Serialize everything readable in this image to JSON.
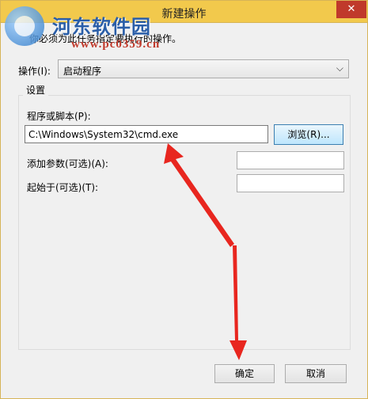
{
  "window": {
    "title": "新建操作",
    "close_symbol": "✕"
  },
  "watermark": {
    "title": "河东软件园",
    "url": "www.pc0359.cn"
  },
  "description": "你必须为此任务指定要执行的操作。",
  "action": {
    "label": "操作(I):",
    "selected": "启动程序",
    "arrow_icon": "chevron-down-icon"
  },
  "settings": {
    "group_title": "设置",
    "program_label": "程序或脚本(P):",
    "program_value": "C:\\Windows\\System32\\cmd.exe",
    "browse_label": "浏览(R)...",
    "args_label": "添加参数(可选)(A):",
    "args_value": "",
    "start_label": "起始于(可选)(T):",
    "start_value": ""
  },
  "buttons": {
    "ok": "确定",
    "cancel": "取消"
  },
  "colors": {
    "titlebar": "#f2c94c",
    "annotation_arrow": "#e8261f"
  }
}
